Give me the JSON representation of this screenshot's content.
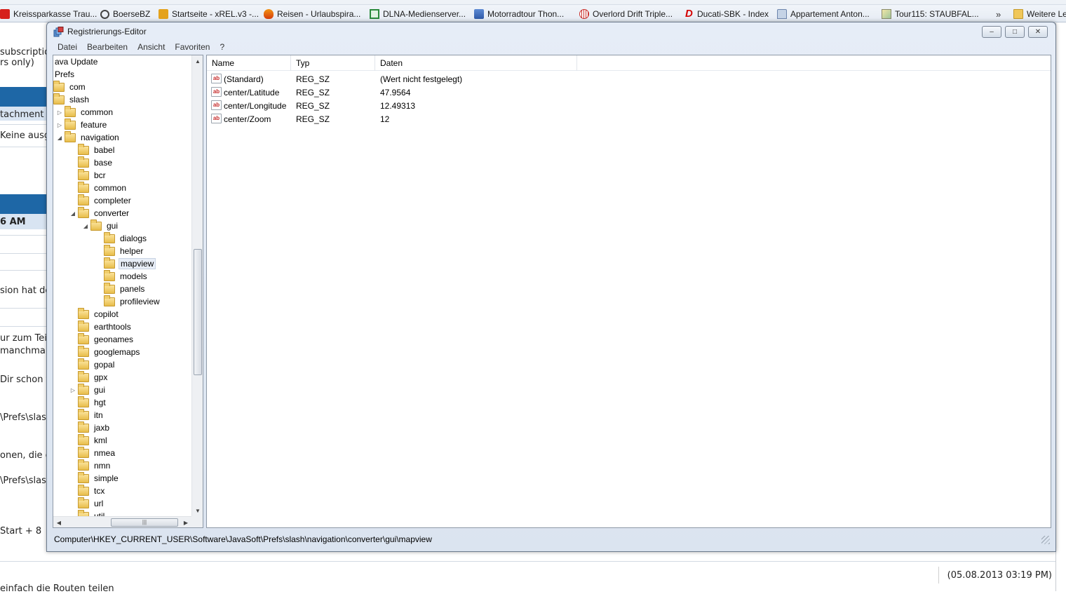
{
  "bookmarks": [
    {
      "label": "Kreissparkasse Trau...",
      "icon": "sparkasse-icon"
    },
    {
      "label": "BoerseBZ",
      "icon": "boerse-icon"
    },
    {
      "label": "Startseite - xREL.v3 -...",
      "icon": "xrel-icon"
    },
    {
      "label": "Reisen - Urlaubspira...",
      "icon": "urlaubspiraten-icon"
    },
    {
      "label": "DLNA-Medienserver...",
      "icon": "dlna-icon"
    },
    {
      "label": "Motorradtour Thon...",
      "icon": "motorradtour-icon"
    },
    {
      "label": "Overlord Drift Triple...",
      "icon": "overlord-icon"
    },
    {
      "label": "Ducati-SBK - Index",
      "icon": "ducati-icon"
    },
    {
      "label": "Appartement Anton...",
      "icon": "appartement-icon"
    },
    {
      "label": "Tour115: STAUBFAL...",
      "icon": "tour-icon"
    },
    {
      "label": "»",
      "icon": "chevron-more-icon"
    },
    {
      "label": "Weitere Le",
      "icon": "folder-icon"
    }
  ],
  "background_page": {
    "snippets": [
      "subscription",
      "rs only)",
      "tachment us",
      "Keine ausge",
      "6 AM",
      "sion hat de",
      "ur zum Tei",
      " manchmal",
      "Dir schon f",
      "\\Prefs\\slas",
      "onen, die g",
      "\\Prefs\\slas",
      "Start + 8",
      "einfach die Routen teilen"
    ],
    "date_stamp": "(05.08.2013 03:19 PM)"
  },
  "window": {
    "title": "Registrierungs-Editor",
    "menu": [
      "Datei",
      "Bearbeiten",
      "Ansicht",
      "Favoriten",
      "?"
    ],
    "buttons": {
      "minimize": "–",
      "maximize": "□",
      "close": "✕"
    }
  },
  "tree": [
    {
      "label": "ava Update",
      "level": 0,
      "expander": "",
      "folder": false
    },
    {
      "label": "Prefs",
      "level": 0,
      "expander": "",
      "folder": false
    },
    {
      "label": "com",
      "level": 0,
      "expander": "",
      "folder": true
    },
    {
      "label": "slash",
      "level": 0,
      "expander": "",
      "folder": true
    },
    {
      "label": "common",
      "level": 1,
      "expander": "▷",
      "folder": true
    },
    {
      "label": "feature",
      "level": 1,
      "expander": "▷",
      "folder": true
    },
    {
      "label": "navigation",
      "level": 1,
      "expander": "◢",
      "folder": true
    },
    {
      "label": "babel",
      "level": 2,
      "expander": "",
      "folder": true
    },
    {
      "label": "base",
      "level": 2,
      "expander": "",
      "folder": true
    },
    {
      "label": "bcr",
      "level": 2,
      "expander": "",
      "folder": true
    },
    {
      "label": "common",
      "level": 2,
      "expander": "",
      "folder": true
    },
    {
      "label": "completer",
      "level": 2,
      "expander": "",
      "folder": true
    },
    {
      "label": "converter",
      "level": 2,
      "expander": "◢",
      "folder": true
    },
    {
      "label": "gui",
      "level": 3,
      "expander": "◢",
      "folder": true
    },
    {
      "label": "dialogs",
      "level": 4,
      "expander": "",
      "folder": true
    },
    {
      "label": "helper",
      "level": 4,
      "expander": "",
      "folder": true
    },
    {
      "label": "mapview",
      "level": 4,
      "expander": "",
      "folder": true,
      "selected": true
    },
    {
      "label": "models",
      "level": 4,
      "expander": "",
      "folder": true
    },
    {
      "label": "panels",
      "level": 4,
      "expander": "",
      "folder": true
    },
    {
      "label": "profileview",
      "level": 4,
      "expander": "",
      "folder": true
    },
    {
      "label": "copilot",
      "level": 2,
      "expander": "",
      "folder": true
    },
    {
      "label": "earthtools",
      "level": 2,
      "expander": "",
      "folder": true
    },
    {
      "label": "geonames",
      "level": 2,
      "expander": "",
      "folder": true
    },
    {
      "label": "googlemaps",
      "level": 2,
      "expander": "",
      "folder": true
    },
    {
      "label": "gopal",
      "level": 2,
      "expander": "",
      "folder": true
    },
    {
      "label": "gpx",
      "level": 2,
      "expander": "",
      "folder": true
    },
    {
      "label": "gui",
      "level": 2,
      "expander": "▷",
      "folder": true
    },
    {
      "label": "hgt",
      "level": 2,
      "expander": "",
      "folder": true
    },
    {
      "label": "itn",
      "level": 2,
      "expander": "",
      "folder": true
    },
    {
      "label": "jaxb",
      "level": 2,
      "expander": "",
      "folder": true
    },
    {
      "label": "kml",
      "level": 2,
      "expander": "",
      "folder": true
    },
    {
      "label": "nmea",
      "level": 2,
      "expander": "",
      "folder": true
    },
    {
      "label": "nmn",
      "level": 2,
      "expander": "",
      "folder": true
    },
    {
      "label": "simple",
      "level": 2,
      "expander": "",
      "folder": true
    },
    {
      "label": "tcx",
      "level": 2,
      "expander": "",
      "folder": true
    },
    {
      "label": "url",
      "level": 2,
      "expander": "",
      "folder": true
    },
    {
      "label": "util",
      "level": 2,
      "expander": "",
      "folder": true
    }
  ],
  "list": {
    "columns": [
      "Name",
      "Typ",
      "Daten"
    ],
    "rows": [
      {
        "icon": "ab",
        "name": "(Standard)",
        "type": "REG_SZ",
        "data": "(Wert nicht festgelegt)"
      },
      {
        "icon": "ab",
        "name": "center/Latitude",
        "type": "REG_SZ",
        "data": "47.9564"
      },
      {
        "icon": "ab",
        "name": "center/Longitude",
        "type": "REG_SZ",
        "data": "12.49313"
      },
      {
        "icon": "ab",
        "name": "center/Zoom",
        "type": "REG_SZ",
        "data": "12"
      }
    ]
  },
  "statusbar": {
    "path": "Computer\\HKEY_CURRENT_USER\\Software\\JavaSoft\\Prefs\\slash\\navigation\\converter\\gui\\mapview"
  }
}
